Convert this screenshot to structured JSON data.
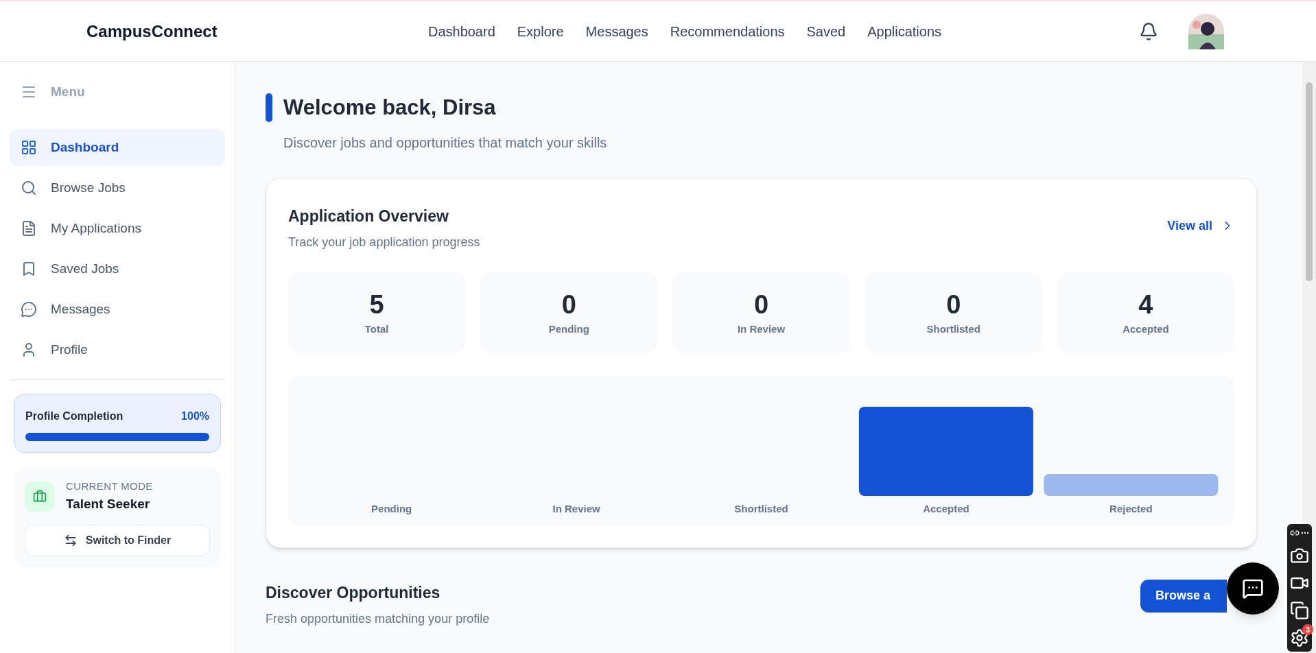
{
  "header": {
    "brand": "CampusConnect",
    "nav": [
      {
        "label": "Dashboard"
      },
      {
        "label": "Explore"
      },
      {
        "label": "Messages"
      },
      {
        "label": "Recommendations"
      },
      {
        "label": "Saved"
      },
      {
        "label": "Applications"
      }
    ]
  },
  "sidebar": {
    "menu_label": "Menu",
    "items": [
      {
        "label": "Dashboard",
        "selected": true
      },
      {
        "label": "Browse Jobs",
        "selected": false
      },
      {
        "label": "My Applications",
        "selected": false
      },
      {
        "label": "Saved Jobs",
        "selected": false
      },
      {
        "label": "Messages",
        "selected": false
      },
      {
        "label": "Profile",
        "selected": false
      }
    ],
    "profile_completion": {
      "label": "Profile Completion",
      "reading": "100%",
      "level": 1
    },
    "mode": {
      "caption": "CURRENT MODE",
      "value": "Talent Seeker",
      "button": "Switch to Finder"
    }
  },
  "welcome": {
    "title": "Welcome back, Dirsa",
    "subtitle": "Discover jobs and opportunities that match your skills"
  },
  "overview": {
    "title": "Application Overview",
    "subtitle": "Track your job application progress",
    "link": "View all",
    "stats": [
      {
        "value": "5",
        "label": "Total"
      },
      {
        "value": "0",
        "label": "Pending"
      },
      {
        "value": "0",
        "label": "In Review"
      },
      {
        "value": "0",
        "label": "Shortlisted"
      },
      {
        "value": "4",
        "label": "Accepted"
      }
    ],
    "chart": {
      "kind": "picture",
      "categories": [
        "Pending",
        "In Review",
        "Shortlisted",
        "Accepted",
        "Rejected"
      ]
    }
  },
  "discover": {
    "title": "Discover Opportunities",
    "subtitle": "Fresh opportunities matching your profile",
    "button": "Browse a"
  },
  "recorder": {
    "badge": "3"
  }
}
